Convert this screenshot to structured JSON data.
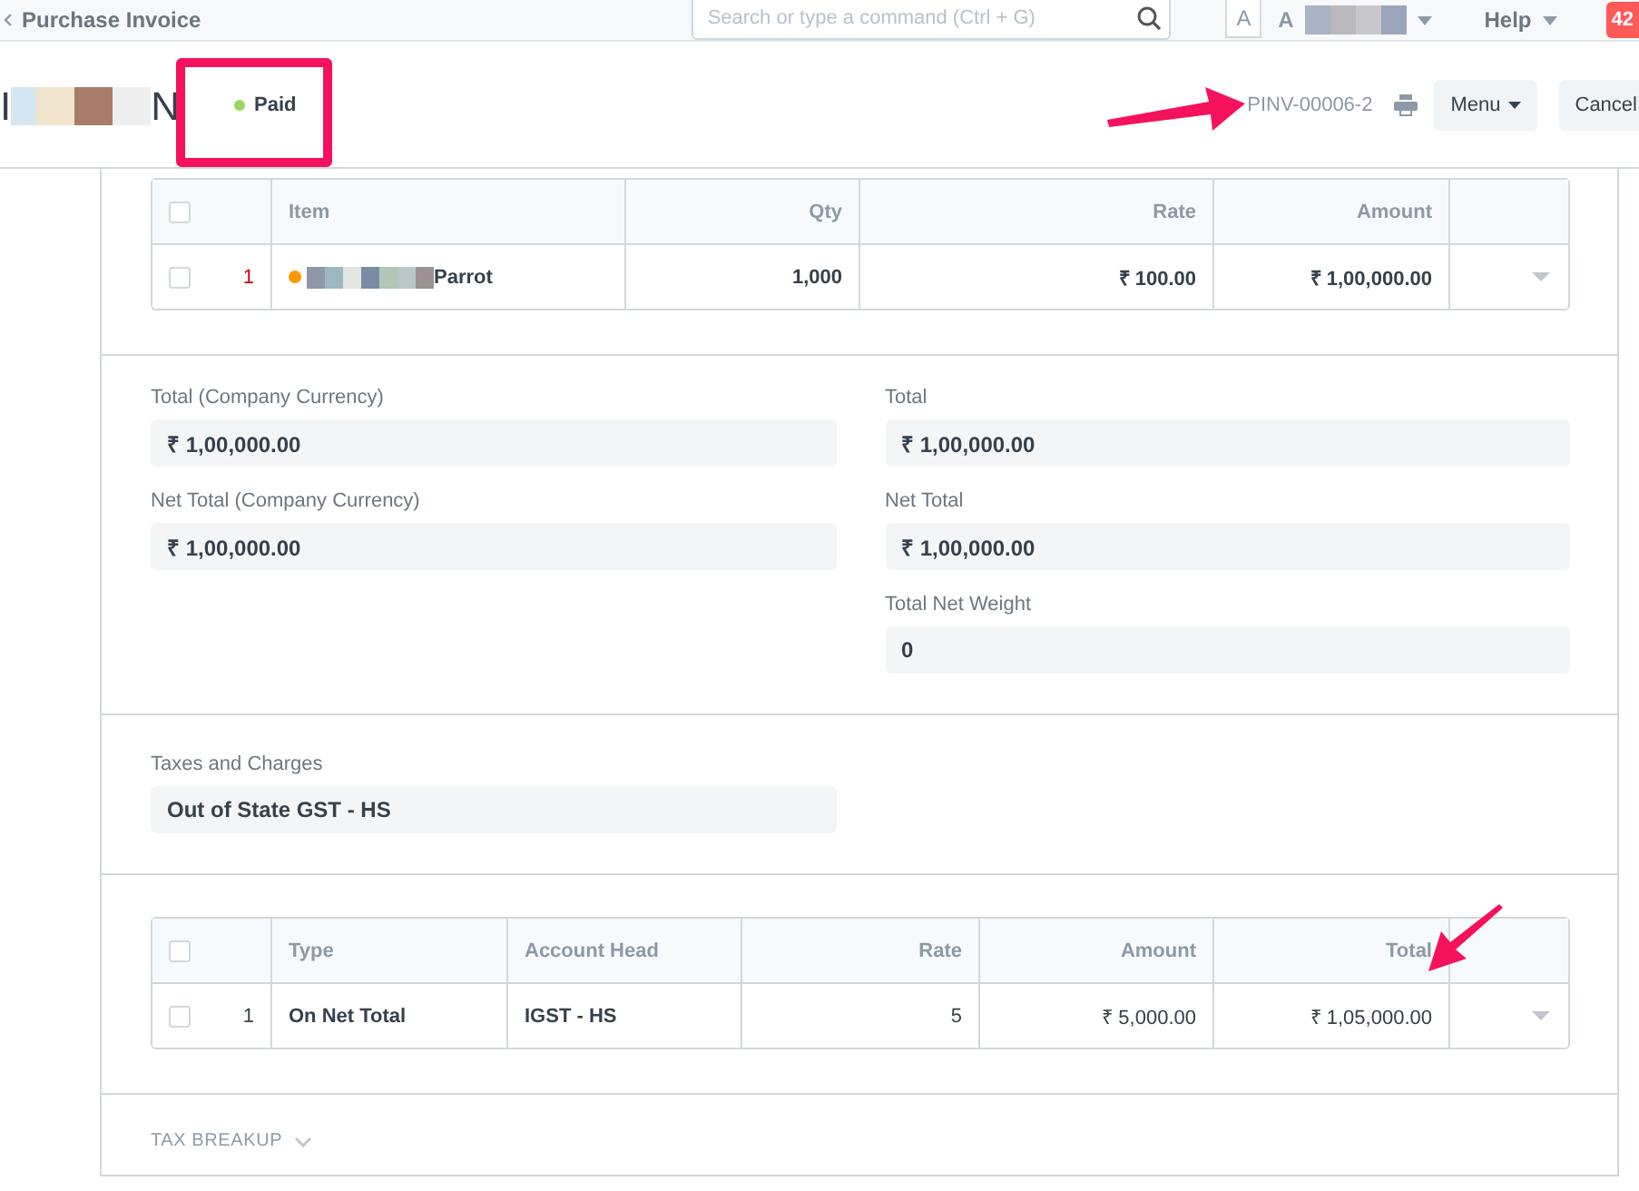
{
  "navbar": {
    "breadcrumb": "Purchase Invoice",
    "search": {
      "placeholder": "Search or type a command (Ctrl + G)"
    },
    "avatar_letter": "A",
    "user_initial": "A",
    "help": "Help",
    "notification_count": "42"
  },
  "header": {
    "title_start": "I",
    "title_end": "N",
    "status": {
      "label": "Paid",
      "color": "#98d85b"
    },
    "doc_name": "PINV-00006-2",
    "buttons": [
      "Menu",
      "Cancel"
    ]
  },
  "items_table": {
    "all_checked": false,
    "columns": [
      "Item",
      "Qty",
      "Rate",
      "Amount"
    ],
    "rows": [
      {
        "checked": false,
        "index": "1",
        "item": "Parrot",
        "color": "#ff9800",
        "qty": "1,000",
        "rate": "₹ 100.00",
        "amount": "₹ 1,00,000.00"
      }
    ]
  },
  "totals": {
    "left": [
      {
        "label": "Total (Company Currency)",
        "value": "₹ 1,00,000.00"
      },
      {
        "label": "Net Total (Company Currency)",
        "value": "₹ 1,00,000.00"
      }
    ],
    "right": [
      {
        "label": "Total",
        "value": "₹ 1,00,000.00"
      },
      {
        "label": "Net Total",
        "value": "₹ 1,00,000.00"
      },
      {
        "label": "Total Net Weight",
        "value": "0"
      }
    ]
  },
  "taxes_and_charges": {
    "label": "Taxes and Charges",
    "value": "Out of State GST - HS"
  },
  "taxes_table": {
    "all_checked": false,
    "columns": [
      "Type",
      "Account Head",
      "Rate",
      "Amount",
      "Total"
    ],
    "rows": [
      {
        "checked": false,
        "index": "1",
        "type": "On Net Total",
        "account_head": "IGST - HS",
        "rate": "5",
        "amount": "₹ 5,000.00",
        "total": "₹ 1,05,000.00"
      }
    ]
  },
  "tax_breakup": {
    "label": "TAX BREAKUP",
    "expanded": false
  }
}
